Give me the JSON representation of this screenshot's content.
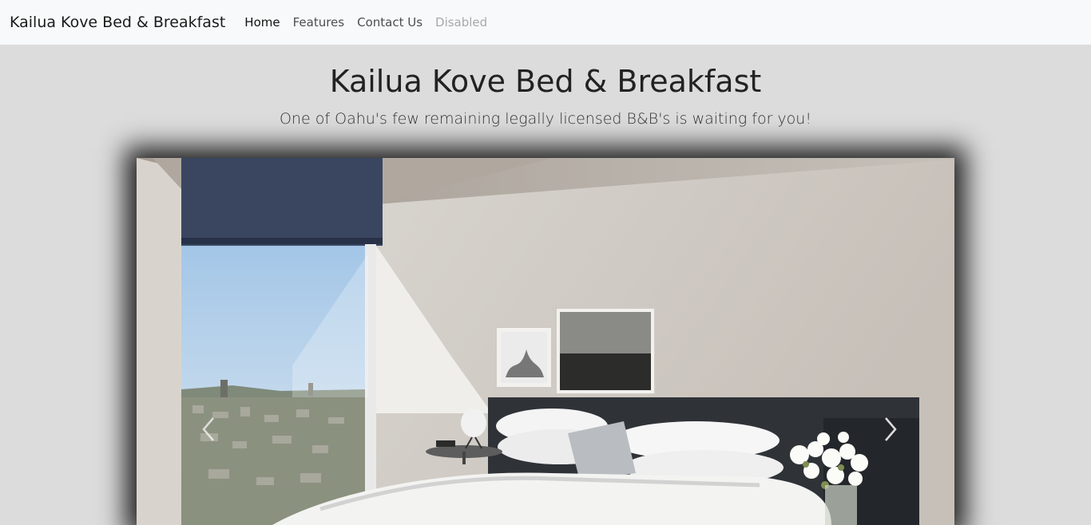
{
  "navbar": {
    "brand": "Kailua Kove Bed & Breakfast",
    "links": [
      {
        "label": "Home",
        "state": "active"
      },
      {
        "label": "Features",
        "state": "normal"
      },
      {
        "label": "Contact Us",
        "state": "normal"
      },
      {
        "label": "Disabled",
        "state": "disabled"
      }
    ]
  },
  "hero": {
    "title": "Kailua Kove Bed & Breakfast",
    "subtitle": "One of Oahu's few remaining legally licensed B&B's is waiting for you!"
  },
  "carousel": {
    "slide_image": "bedroom-photo",
    "prev_icon": "chevron-left-icon",
    "next_icon": "chevron-right-icon"
  },
  "colors": {
    "navbar_bg": "#f8f9fa",
    "page_bg": "#dcdcdc",
    "text_dark": "#222222",
    "nav_disabled": "#a9a9a9"
  }
}
